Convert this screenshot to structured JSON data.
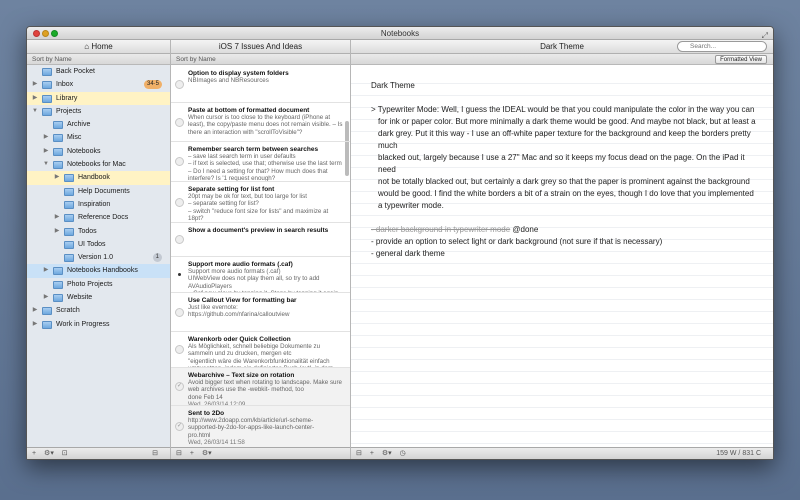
{
  "window": {
    "title": "Notebooks"
  },
  "sidebar": {
    "header": "⌂ Home",
    "sort": "Sort by Name",
    "items": [
      {
        "label": "Back Pocket",
        "level": 0,
        "disc": "",
        "badge": "",
        "state": ""
      },
      {
        "label": "Inbox",
        "level": 0,
        "disc": "▶",
        "badge": "34·5",
        "badgeStyle": "orange",
        "state": ""
      },
      {
        "label": "Library",
        "level": 0,
        "disc": "▶",
        "badge": "",
        "state": "yellow"
      },
      {
        "label": "Projects",
        "level": 0,
        "disc": "▼",
        "badge": "",
        "state": ""
      },
      {
        "label": "Archive",
        "level": 1,
        "disc": "",
        "badge": "",
        "state": ""
      },
      {
        "label": "Misc",
        "level": 1,
        "disc": "▶",
        "badge": "",
        "state": ""
      },
      {
        "label": "Notebooks",
        "level": 1,
        "disc": "▶",
        "badge": "",
        "state": ""
      },
      {
        "label": "Notebooks for Mac",
        "level": 1,
        "disc": "▼",
        "badge": "",
        "state": ""
      },
      {
        "label": "Handbook",
        "level": 2,
        "disc": "▶",
        "badge": "",
        "state": "yellow"
      },
      {
        "label": "Help Documents",
        "level": 2,
        "disc": "",
        "badge": "",
        "state": ""
      },
      {
        "label": "Inspiration",
        "level": 2,
        "disc": "",
        "badge": "",
        "state": ""
      },
      {
        "label": "Reference Docs",
        "level": 2,
        "disc": "▶",
        "badge": "",
        "state": ""
      },
      {
        "label": "Todos",
        "level": 2,
        "disc": "▶",
        "badge": "",
        "state": ""
      },
      {
        "label": "UI Todos",
        "level": 2,
        "disc": "",
        "badge": "",
        "state": ""
      },
      {
        "label": "Version 1.0",
        "level": 2,
        "disc": "",
        "badge": "1",
        "badgeStyle": "",
        "state": ""
      },
      {
        "label": "Notebooks Handbooks",
        "level": 1,
        "disc": "▶",
        "badge": "",
        "state": "blue"
      },
      {
        "label": "Photo Projects",
        "level": 1,
        "disc": "",
        "badge": "",
        "state": ""
      },
      {
        "label": "Website",
        "level": 1,
        "disc": "▶",
        "badge": "",
        "state": ""
      },
      {
        "label": "Scratch",
        "level": 0,
        "disc": "▶",
        "badge": "",
        "state": ""
      },
      {
        "label": "Work in Progress",
        "level": 0,
        "disc": "▶",
        "badge": "",
        "state": ""
      }
    ],
    "bottom": [
      "+",
      "⚙▾",
      "⊡",
      "⊟"
    ]
  },
  "list": {
    "header": "iOS 7 Issues And Ideas",
    "sort": "Sort by Name",
    "items": [
      {
        "title": "Option to display system folders",
        "lines": [
          "NBImages and NBResources"
        ],
        "date": "",
        "state": "open",
        "h": 37
      },
      {
        "title": "Paste at bottom of formatted document",
        "lines": [
          "When cursor is too close to the keyboard (iPhone at",
          "least), the copy/paste menu does not remain visible. – Is",
          "there an interaction with \"scrollToVisible\"?"
        ],
        "date": "",
        "state": "open",
        "h": 39
      },
      {
        "title": "Remember search term between searches",
        "lines": [
          "– save last search term in user defaults",
          "– if text is selected, use that; otherwise use the last term",
          "– Do I need a setting for that? How much does that",
          "interfere? Is '1 request enough?"
        ],
        "date": "",
        "state": "open",
        "h": 40
      },
      {
        "title": "Separate setting for list font",
        "lines": [
          "20pt may be ok for text, but too large for list",
          "– separate setting for list?",
          "– switch \"reduce font size for lists\" and maximize at",
          "18pt?"
        ],
        "date": "",
        "state": "open",
        "h": 41
      },
      {
        "title": "Show a document's preview in search results",
        "lines": [],
        "date": "",
        "state": "open",
        "h": 34
      },
      {
        "title": "Support more audio formats (.caf)",
        "lines": [
          "Support more audio formats (.caf)",
          "UIWebView does not play them all, so try to add",
          "AVAudioPlayers",
          "– Caf now plays by tapping it. Stops by tapping it again"
        ],
        "date": "",
        "state": "dot",
        "h": 36
      },
      {
        "title": "Use Callout View for formatting bar",
        "lines": [
          "Just like evernote:",
          "https://github.com/nfarina/calloutview"
        ],
        "date": "",
        "state": "open",
        "h": 39
      },
      {
        "title": "Warenkorb oder Quick Collection",
        "lines": [
          "Als Möglichkeit, schnell beliebige Dokumente zu",
          "sammeln und zu drucken, mergen etc",
          "\"eigentlich wäre die Warenkorbfunktionalität einfach",
          "umzusetzen, indem ein definiertes Buch (evtl. in dem"
        ],
        "date": "",
        "state": "open",
        "h": 36
      },
      {
        "title": "Webarchive – Text size on rotation",
        "lines": [
          "Avoid bigger text when rotating to landscape. Make sure",
          "web archives use the -webkit- method, too",
          "done Feb 14"
        ],
        "date": "Wed, 26/03/14 12:09",
        "state": "done",
        "h": 38
      },
      {
        "title": "Sent to 2Do",
        "lines": [
          "http://www.2doapp.com/kb/article/url-scheme-",
          "supported-by-2do-for-apps-like-launch-center-",
          "pro.html"
        ],
        "date": "Wed, 26/03/14 11:58",
        "state": "done",
        "h": 42
      }
    ],
    "bottom": [
      "⊟",
      "+",
      "⚙▾"
    ]
  },
  "editor": {
    "header": "Dark Theme",
    "search_placeholder": "Search...",
    "formatted_view": "Formatted View",
    "heading": "Dark Theme",
    "para": "> Typewriter Mode: Well, I guess the IDEAL would be that you could manipulate the color in the way you can",
    "para_lines": [
      "for ink or paper color. But more minimally a dark theme would be good. And maybe not black, but at least a",
      "dark grey. Put it this way - I use an off-white paper texture for the background and keep the borders pretty much",
      "blacked out, largely because I use a 27\" Mac and so it keeps my focus dead on the page. On the iPad it need",
      "not be totally blacked out, but certainly a dark grey so that the paper is prominent against the background",
      "would be good. I find the white borders a bit of a strain on the eyes, though I do love that you implemented",
      "a typewriter mode."
    ],
    "strike_text": "- darker background in typewriter mode",
    "done_tag": " @done",
    "bullet1": "- provide an option to select light or dark background (not sure if that is necessary)",
    "bullet2": "- general dark theme",
    "bottom": [
      "⊟",
      "+",
      "⚙▾",
      "◷"
    ],
    "word_count": "159 W / 831 C"
  }
}
